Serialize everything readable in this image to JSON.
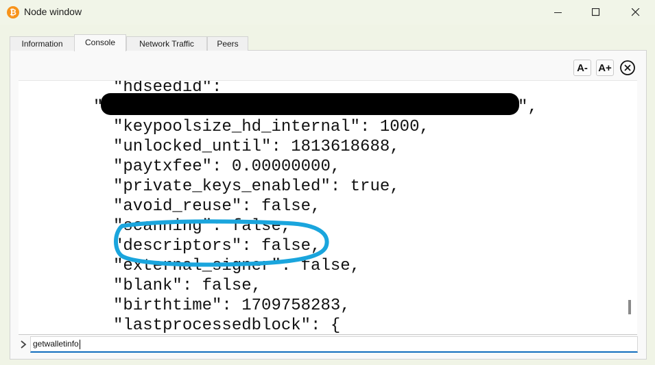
{
  "window": {
    "title": "Node window",
    "app_icon": "bitcoin-icon"
  },
  "tabs": [
    "Information",
    "Console",
    "Network Traffic",
    "Peers"
  ],
  "active_tab": "Console",
  "font_controls": {
    "decrease": "A-",
    "increase": "A+"
  },
  "console_lines": [
    "\"hdseedid\":",
    "\"",
    "\",",
    "\"keypoolsize_hd_internal\": 1000,",
    "\"unlocked_until\": 1813618688,",
    "\"paytxfee\": 0.00000000,",
    "\"private_keys_enabled\": true,",
    "\"avoid_reuse\": false,",
    "\"scanning\": false,",
    "\"descriptors\": false,",
    "\"external_signer\": false,",
    "\"blank\": false,",
    "\"birthtime\": 1709758283,",
    "\"lastprocessedblock\": {"
  ],
  "command_input": {
    "value": "getwalletinfo"
  },
  "colors": {
    "annotation": "#1aa5dd",
    "input_focus": "#0f6cbd",
    "bitcoin": "#f7931a"
  }
}
